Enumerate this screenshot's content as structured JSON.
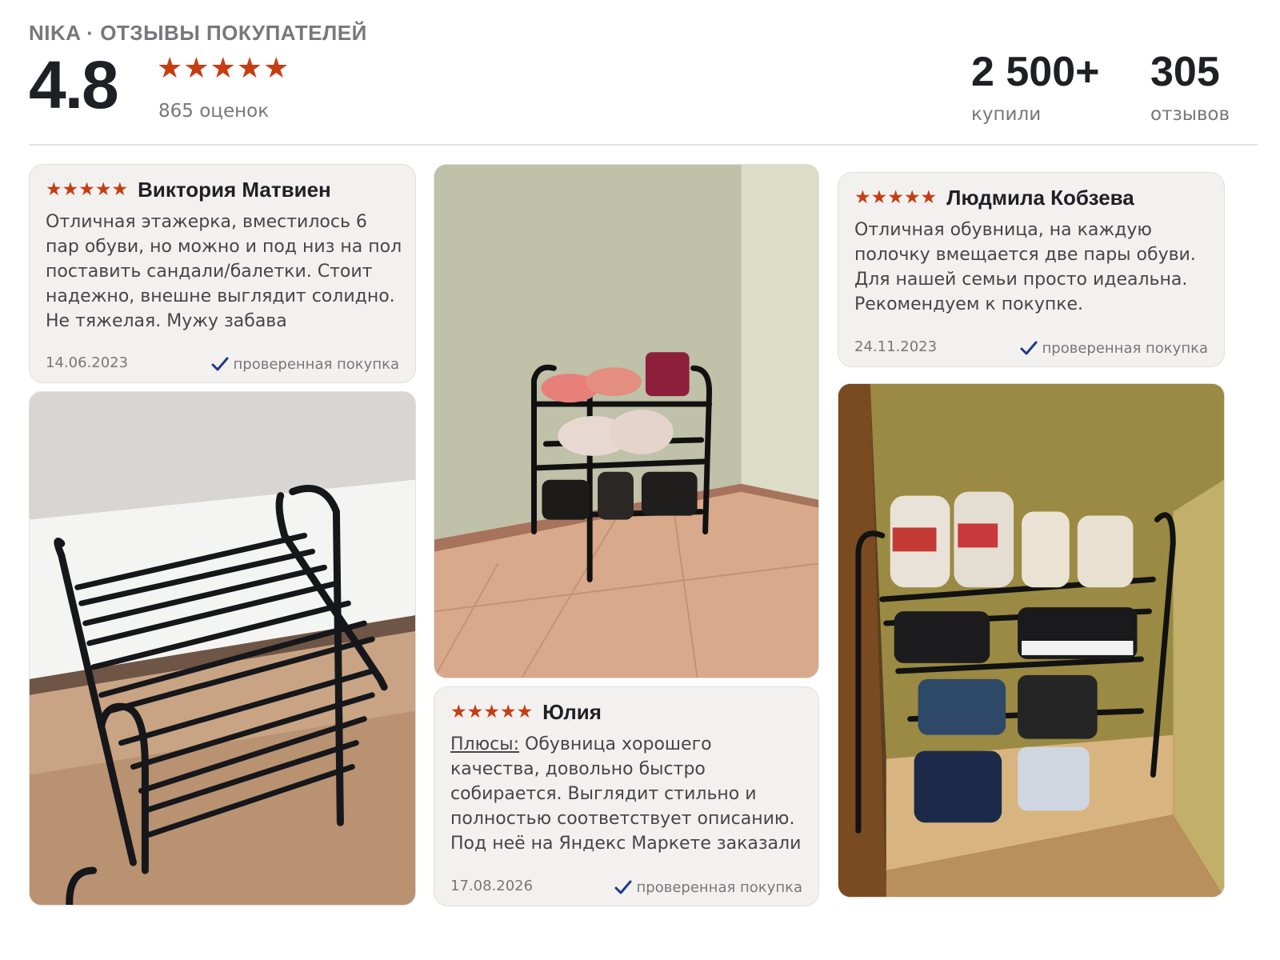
{
  "header": {
    "brand": "NIKA · ОТЗЫВЫ ПОКУПАТЕЛЕЙ",
    "rating": "4.8",
    "stars": 5,
    "rating_count": "865 оценок",
    "stats": [
      {
        "value": "2 500+",
        "label": "купили"
      },
      {
        "value": "305",
        "label": "отзывов"
      }
    ]
  },
  "reviews": [
    {
      "stars": 5,
      "author": "Виктория Матвиен",
      "text": "Отличная этажерка, вместилось 6 пар обуви, но можно и под низ на пол поставить сандали/балетки. Стоит надежно, внешне выглядит солидно. Не тяжелая. Мужу забава пособирать...",
      "date": "14.06.2023",
      "verified": "проверенная покупка"
    },
    {
      "stars": 5,
      "author": "Юлия",
      "pros_label": "Плюсы:",
      "text": " Обувница хорошего качества, довольно быстро собирается. Выглядит стильно и полностью соответствует описанию. Под неё на Яндекс Маркете заказали серый...",
      "date": "17.08.2026",
      "verified": "проверенная покупка"
    },
    {
      "stars": 5,
      "author": "Людмила Кобзева",
      "text": "Отличная обувница, на каждую полочку вмещается две пары обуви. Для нашей семьи просто идеальна. Рекомендуем к покупке.",
      "date": "24.11.2023",
      "verified": "проверенная покупка"
    }
  ],
  "colors": {
    "star": "#c63d12",
    "card_bg": "#f2f1ef",
    "check": "#1f3a8a"
  },
  "icons": {
    "star": "star-icon",
    "check": "check-icon"
  }
}
